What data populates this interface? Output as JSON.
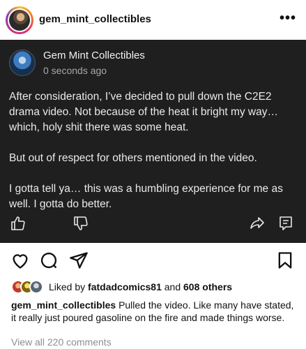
{
  "header": {
    "username": "gem_mint_collectibles",
    "more_label": "•••"
  },
  "post_card": {
    "author": "Gem Mint Collectibles",
    "time": "0 seconds ago",
    "paragraphs": [
      "After consideration, I’ve decided to pull down the C2E2 drama video. Not because of the heat it bright my way… which, holy shit there was some heat.",
      "But out of respect for others mentioned in the video.",
      "I gotta tell ya… this was a humbling experience for me as well. I gotta do better."
    ],
    "icons": [
      "thumbs-up-icon",
      "thumbs-down-icon",
      "share-arrow-icon",
      "comment-icon"
    ]
  },
  "actions": {
    "icons": [
      "heart-icon",
      "comment-bubble-icon",
      "send-icon",
      "bookmark-icon"
    ]
  },
  "likes": {
    "prefix": "Liked by",
    "user": "fatdadcomics81",
    "conjunction": "and",
    "others": "608 others"
  },
  "caption": {
    "username": "gem_mint_collectibles",
    "text": "Pulled the video. Like many have stated, it really just poured gasoline on the fire and made things worse."
  },
  "comments": {
    "view_all": "View all 220 comments"
  }
}
